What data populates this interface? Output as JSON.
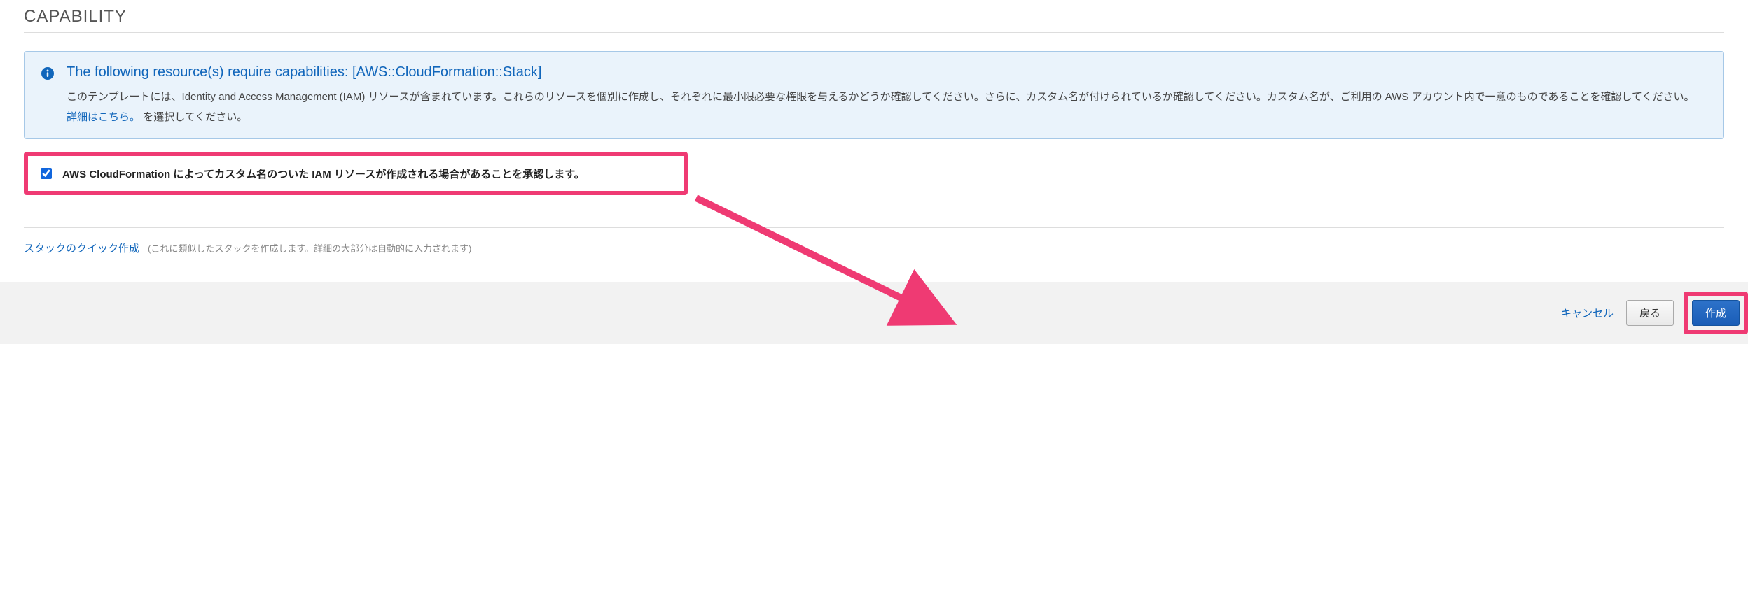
{
  "section": {
    "title": "CAPABILITY"
  },
  "alert": {
    "heading": "The following resource(s) require capabilities: [AWS::CloudFormation::Stack]",
    "body_pre": "このテンプレートには、Identity and Access Management (IAM) リソースが含まれています。これらのリソースを個別に作成し、それぞれに最小限必要な権限を与えるかどうか確認してください。さらに、カスタム名が付けられているか確認してください。カスタム名が、ご利用の AWS アカウント内で一意のものであることを確認してください。 ",
    "link": "詳細はこちら。",
    "body_post": " を選択してください。"
  },
  "consent": {
    "label": "AWS CloudFormation によってカスタム名のついた IAM リソースが作成される場合があることを承認します。",
    "checked": true
  },
  "quick": {
    "link": "スタックのクイック作成",
    "hint": "(これに類似したスタックを作成します。詳細の大部分は自動的に入力されます)"
  },
  "footer": {
    "cancel": "キャンセル",
    "back": "戻る",
    "create": "作成"
  },
  "annotation": {
    "arrow_color": "#ef3a73"
  }
}
